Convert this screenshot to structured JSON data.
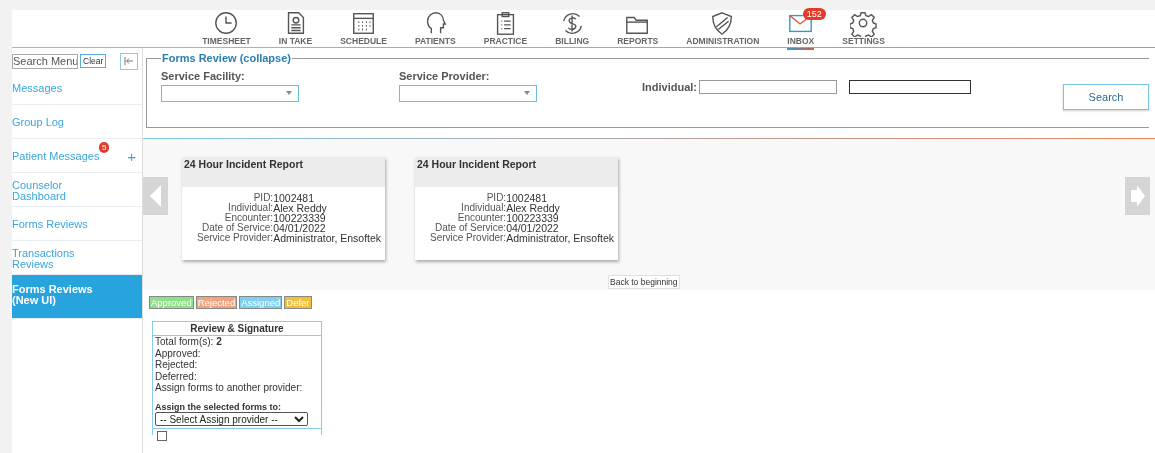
{
  "nav": {
    "items": [
      {
        "label": "TIMESHEET",
        "selected": false
      },
      {
        "label": "IN TAKE",
        "selected": false
      },
      {
        "label": "SCHEDULE",
        "selected": false
      },
      {
        "label": "PATIENTS",
        "selected": false
      },
      {
        "label": "PRACTICE",
        "selected": false
      },
      {
        "label": "BILLING",
        "selected": false
      },
      {
        "label": "REPORTS",
        "selected": false
      },
      {
        "label": "ADMINISTRATION",
        "selected": false
      },
      {
        "label": "INBOX",
        "selected": true,
        "badge": "152"
      },
      {
        "label": "SETTINGS",
        "selected": false
      }
    ]
  },
  "sidebar": {
    "search": {
      "placeholder": "Search Menu"
    },
    "clear": "Clear",
    "items": [
      {
        "label": "Messages",
        "selected": false
      },
      {
        "label": "Group Log",
        "selected": false
      },
      {
        "label": "Patient Messages",
        "selected": false,
        "badge": "5",
        "plus": "+"
      },
      {
        "label": "Counselor Dashboard",
        "selected": false
      },
      {
        "label": "Forms Reviews",
        "selected": false
      },
      {
        "label": "Transactions Reviews",
        "selected": false
      },
      {
        "label": "Forms Reviews (New UI)",
        "selected": true
      }
    ]
  },
  "filter": {
    "legend": "Forms Review (collapse)",
    "facility_label": "Service Facility:",
    "provider_label": "Service Provider:",
    "individual_label": "Individual:",
    "search": "Search"
  },
  "cards": [
    {
      "title": "24 Hour Incident Report",
      "fields": [
        {
          "label": "PID:",
          "value": "1002481"
        },
        {
          "label": "Individual:",
          "value": "Alex Reddy"
        },
        {
          "label": "Encounter:",
          "value": "100223339"
        },
        {
          "label": "Date of Service:",
          "value": "04/01/2022"
        },
        {
          "label": "Service Provider:",
          "value": "Administrator, Ensoftek"
        }
      ]
    },
    {
      "title": "24 Hour Incident Report",
      "fields": [
        {
          "label": "PID:",
          "value": "1002481"
        },
        {
          "label": "Individual:",
          "value": "Alex Reddy"
        },
        {
          "label": "Encounter:",
          "value": "100223339"
        },
        {
          "label": "Date of Service:",
          "value": "04/01/2022"
        },
        {
          "label": "Service Provider:",
          "value": "Administrator, Ensoftek"
        }
      ]
    }
  ],
  "back_to_beginning": "Back to beginning",
  "legend": [
    {
      "label": "Approved",
      "color": "#8fe08a"
    },
    {
      "label": "Rejected",
      "color": "#f0a27e"
    },
    {
      "label": "Assigned",
      "color": "#7fcff0"
    },
    {
      "label": "Defer",
      "color": "#f3bf3a"
    }
  ],
  "review": {
    "title": "Review & Signature",
    "lines": [
      "Total form(s): **2**",
      "Approved:",
      "Rejected:",
      "Deferred:",
      "Assign forms to another provider:"
    ],
    "assign_label": "Assign the selected forms to:",
    "assign_select": "-- Select Assign provider --",
    "checkbox": {
      "checked": false
    }
  }
}
